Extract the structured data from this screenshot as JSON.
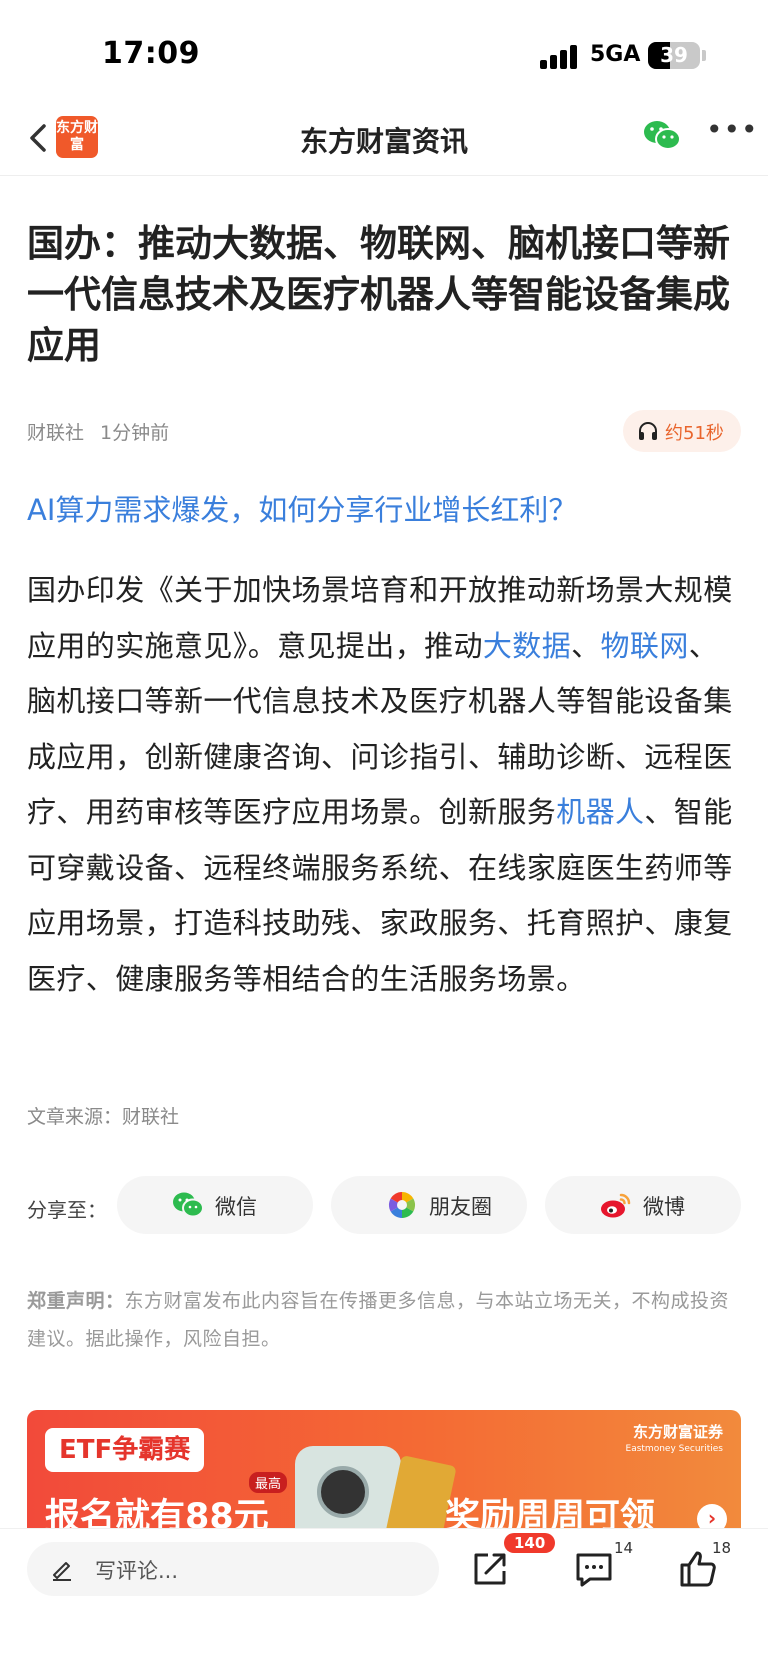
{
  "status_bar": {
    "time": "17:09",
    "network": "5GA",
    "battery": "39"
  },
  "nav": {
    "logo_text": "东方财富",
    "title": "东方财富资讯"
  },
  "article": {
    "title": "国办：推动大数据、物联网、脑机接口等新一代信息技术及医疗机器人等智能设备集成应用",
    "source": "财联社",
    "time": "1分钟前",
    "audio_label": "约51秒",
    "promo_link": "AI算力需求爆发，如何分享行业增长红利？",
    "body": {
      "p1": "国办印发《关于加快场景培育和开放推动新场景大规模应用的实施意见》。意见提出，推动",
      "kw1": "大数据",
      "p2": "、",
      "kw2": "物联网",
      "p3": "、脑机接口等新一代信息技术及医疗机器人等智能设备集成应用，创新健康咨询、问诊指引、辅助诊断、远程医疗、用药审核等医疗应用场景。创新服务",
      "kw3": "机器人",
      "p4": "、智能可穿戴设备、远程终端服务系统、在线家庭医生药师等应用场景，打造科技助残、家政服务、托育照护、康复医疗、健康服务等相结合的生活服务场景。"
    },
    "source_line": "文章来源：财联社"
  },
  "share": {
    "label": "分享至：",
    "wechat": "微信",
    "moments": "朋友圈",
    "weibo": "微博"
  },
  "disclaimer": {
    "head": "郑重声明：",
    "text": "东方财富发布此内容旨在传播更多信息，与本站立场无关，不构成投资建议。据此操作，风险自担。"
  },
  "ad": {
    "tag": "ETF争霸赛",
    "broker": "东方财富证券",
    "broker_sub": "Eastmoney Securities",
    "left_text": "报名就有88元",
    "badge": "最高",
    "right_text": "奖励周周可领"
  },
  "bottom_bar": {
    "comment_placeholder": "写评论...",
    "share_count": "140",
    "comment_count": "14",
    "like_count": "18"
  },
  "colors": {
    "accent": "#3a7fdc",
    "brand": "#f0592a",
    "badge": "#f0392b"
  }
}
